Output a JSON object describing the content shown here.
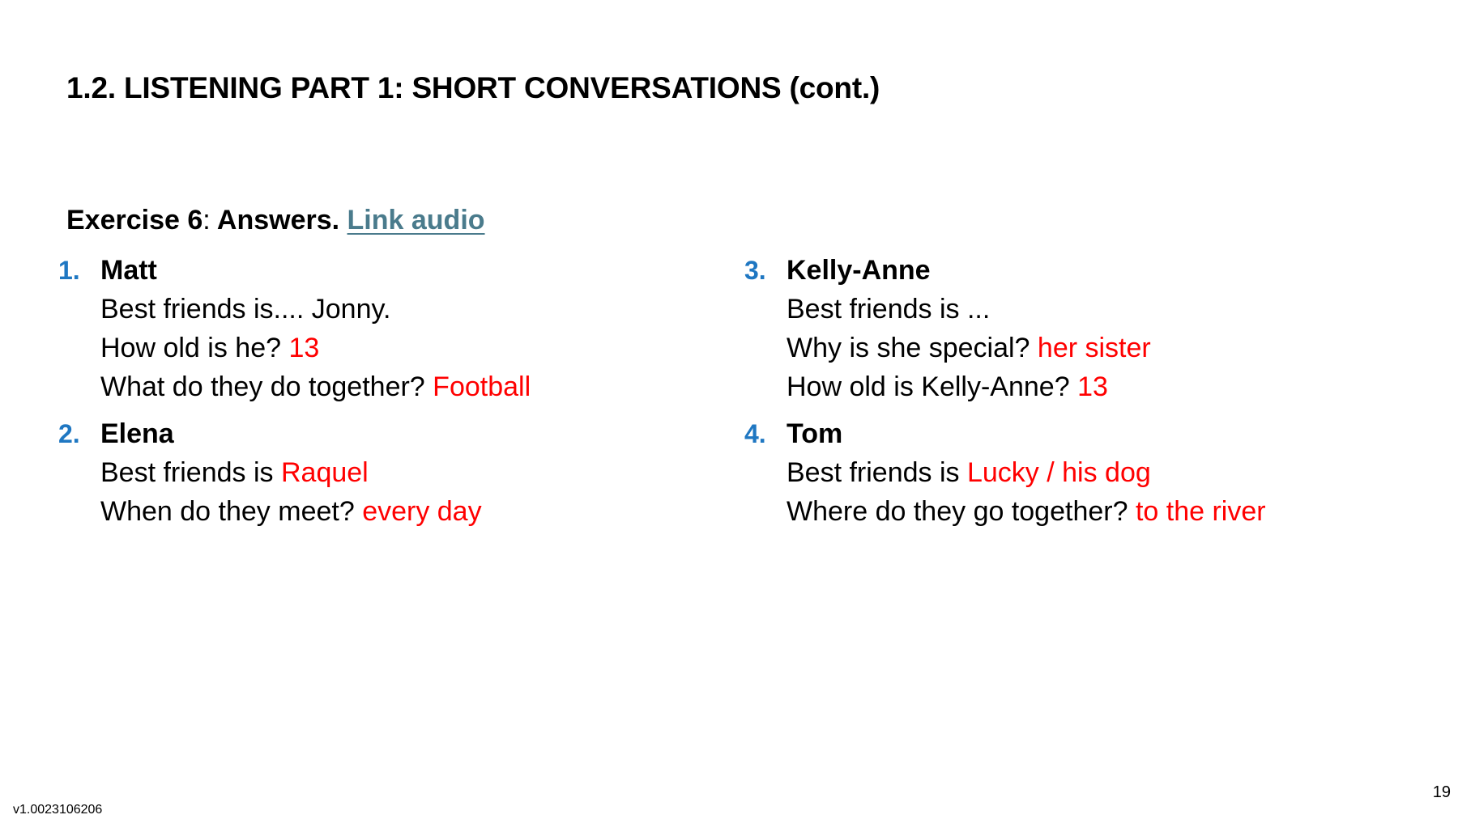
{
  "title": "1.2. LISTENING PART 1: SHORT CONVERSATIONS (cont.)",
  "exercise": {
    "label": "Exercise 6",
    "separator": ":",
    "answers_label": " Answers.",
    "link_text": "Link audio"
  },
  "colors": {
    "text": "#000000",
    "answer": "#ff0000",
    "number": "#1f77c2",
    "link": "#4a7b8c"
  },
  "items": [
    {
      "number": "1.",
      "name": "Matt",
      "lines": [
        {
          "question": "Best friends is.... Jonny.",
          "answer": ""
        },
        {
          "question": "How old is he? ",
          "answer": "13"
        },
        {
          "question": "What do they do together? ",
          "answer": "Football"
        }
      ]
    },
    {
      "number": "2.",
      "name": "Elena",
      "lines": [
        {
          "question": "Best friends is ",
          "answer": "Raquel"
        },
        {
          "question": "When do they meet? ",
          "answer": "every day"
        }
      ]
    },
    {
      "number": "3.",
      "name": "Kelly-Anne",
      "lines": [
        {
          "question": "Best friends is ...",
          "answer": ""
        },
        {
          "question": "Why is she special? ",
          "answer": "her sister"
        },
        {
          "question": "How old is Kelly-Anne? ",
          "answer": "13"
        }
      ]
    },
    {
      "number": "4.",
      "name": "Tom",
      "lines": [
        {
          "question": "Best friends is ",
          "answer": "Lucky / his dog"
        },
        {
          "question": "Where do they go together? ",
          "answer": "to the river"
        }
      ]
    }
  ],
  "footer": {
    "version": "v1.0023106206",
    "page_number": "19"
  }
}
